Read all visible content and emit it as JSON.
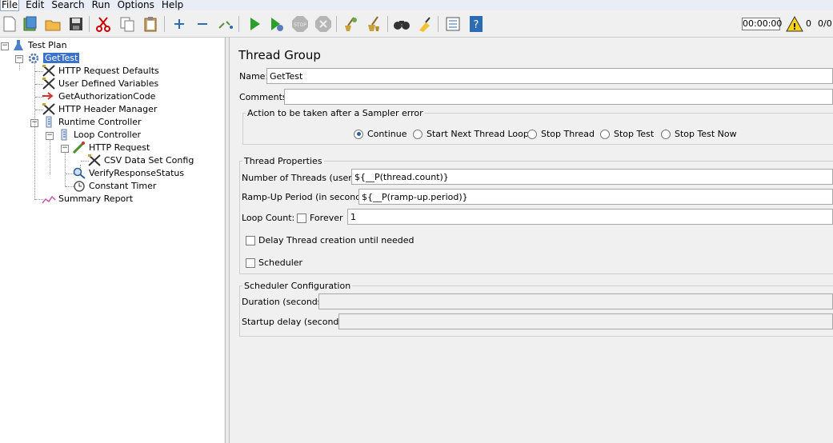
{
  "menu": [
    "File",
    "Edit",
    "Search",
    "Run",
    "Options",
    "Help"
  ],
  "toolbar": {
    "buttons": [
      "new-icon",
      "templates-icon",
      "open-icon",
      "save-icon",
      "cut-icon",
      "copy-icon",
      "paste-icon",
      "expand-icon",
      "collapse-icon",
      "toggle-icon",
      "start-icon",
      "start-no-pause-icon",
      "stop-icon",
      "shutdown-icon",
      "clear-icon",
      "clear-all-icon",
      "search-icon",
      "reset-search-icon",
      "function-helper-icon",
      "help-icon"
    ],
    "timer": "00:00:00",
    "warnings": "0",
    "threads": "0/0"
  },
  "tree": [
    {
      "label": "Test Plan",
      "icon": "test-plan-icon"
    },
    {
      "label": "GetTest",
      "icon": "thread-group-icon",
      "selected": true
    },
    {
      "label": "HTTP Request Defaults",
      "icon": "config-icon"
    },
    {
      "label": "User Defined Variables",
      "icon": "config-icon"
    },
    {
      "label": "GetAuthorizationCode",
      "icon": "module-arrow-icon"
    },
    {
      "label": "HTTP Header Manager",
      "icon": "config-icon"
    },
    {
      "label": "Runtime Controller",
      "icon": "controller-icon"
    },
    {
      "label": "Loop Controller",
      "icon": "controller-icon"
    },
    {
      "label": "HTTP Request",
      "icon": "sampler-icon"
    },
    {
      "label": "CSV Data Set Config",
      "icon": "config-icon"
    },
    {
      "label": "VerifyResponseStatus",
      "icon": "assertion-icon"
    },
    {
      "label": "Constant Timer",
      "icon": "timer-icon"
    },
    {
      "label": "Summary Report",
      "icon": "listener-icon"
    }
  ],
  "panel": {
    "title": "Thread Group",
    "name_label": "Name:",
    "name_value": "GetTest",
    "comments_label": "Comments:",
    "sampler_error": {
      "legend": "Action to be taken after a Sampler error",
      "options": [
        "Continue",
        "Start Next Thread Loop",
        "Stop Thread",
        "Stop Test",
        "Stop Test Now"
      ],
      "selected": "Continue"
    },
    "thread_props": {
      "legend": "Thread Properties",
      "threads_label": "Number of Threads (users):",
      "threads_value": "${__P(thread.count)}",
      "rampup_label": "Ramp-Up Period (in seconds):",
      "rampup_value": "${__P(ramp-up.period)}",
      "loop_label": "Loop Count:",
      "forever_label": "Forever",
      "loop_value": "1",
      "delay_label": "Delay Thread creation until needed",
      "scheduler_label": "Scheduler"
    },
    "scheduler_config": {
      "legend": "Scheduler Configuration",
      "duration_label": "Duration (seconds)",
      "startup_label": "Startup delay (seconds)"
    }
  }
}
